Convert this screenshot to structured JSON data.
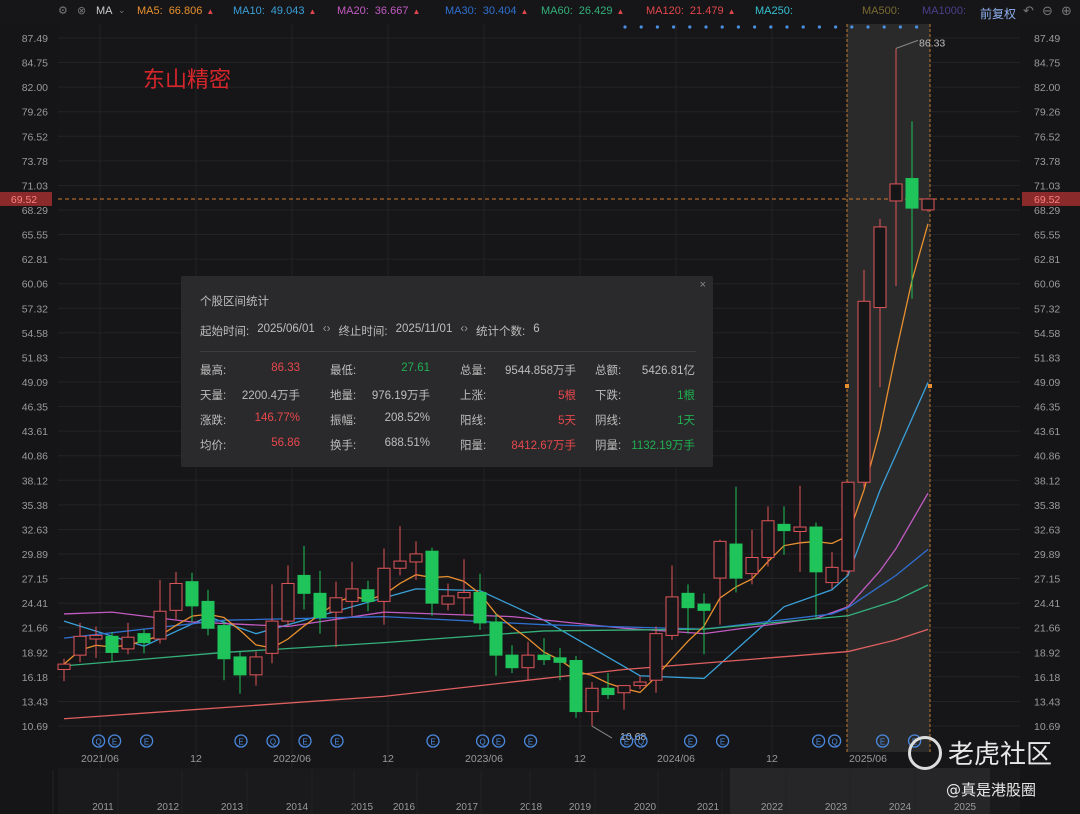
{
  "toolbar": {
    "indicator": "MA",
    "ma": [
      {
        "label": "MA5:",
        "value": "66.806",
        "color": "#e8902f",
        "up": true
      },
      {
        "label": "MA10:",
        "value": "49.043",
        "color": "#3aa0d8",
        "up": true
      },
      {
        "label": "MA20:",
        "value": "36.667",
        "color": "#c25bc2",
        "up": true
      },
      {
        "label": "MA30:",
        "value": "30.404",
        "color": "#2f70d0",
        "up": true
      },
      {
        "label": "MA60:",
        "value": "26.429",
        "color": "#34b07a",
        "up": true
      },
      {
        "label": "MA120:",
        "value": "21.479",
        "color": "#e0474c",
        "up": true
      },
      {
        "label": "MA250:",
        "value": "",
        "color": "#36c0d0",
        "up": false
      },
      {
        "label": "MA500:",
        "value": "",
        "color": "#7a6a30",
        "up": false
      },
      {
        "label": "MA1000:",
        "value": "",
        "color": "#4a3f8a",
        "up": false
      }
    ],
    "adjust": "前复权"
  },
  "stock_name": "东山精密",
  "stats_panel": {
    "title": "个股区间统计",
    "start_label": "起始时间:",
    "start_value": "2025/06/01",
    "end_label": "终止时间:",
    "end_value": "2025/11/01",
    "count_label": "统计个数:",
    "count_value": "6",
    "rows": [
      [
        {
          "k": "最高:",
          "v": "86.33",
          "c": "red"
        },
        {
          "k": "最低:",
          "v": "27.61",
          "c": "green"
        },
        {
          "k": "总量:",
          "v": "9544.858万手",
          "c": ""
        },
        {
          "k": "总额:",
          "v": "5426.81亿",
          "c": ""
        }
      ],
      [
        {
          "k": "天量:",
          "v": "2200.4万手",
          "c": ""
        },
        {
          "k": "地量:",
          "v": "976.19万手",
          "c": ""
        },
        {
          "k": "上涨:",
          "v": "5根",
          "c": "red"
        },
        {
          "k": "下跌:",
          "v": "1根",
          "c": "green"
        }
      ],
      [
        {
          "k": "涨跌:",
          "v": "146.77%",
          "c": "red"
        },
        {
          "k": "振幅:",
          "v": "208.52%",
          "c": ""
        },
        {
          "k": "阳线:",
          "v": "5天",
          "c": "red"
        },
        {
          "k": "阴线:",
          "v": "1天",
          "c": "green"
        }
      ],
      [
        {
          "k": "均价:",
          "v": "56.86",
          "c": "red"
        },
        {
          "k": "换手:",
          "v": "688.51%",
          "c": ""
        },
        {
          "k": "阳量:",
          "v": "8412.67万手",
          "c": "red"
        },
        {
          "k": "阴量:",
          "v": "1132.19万手",
          "c": "green"
        }
      ]
    ]
  },
  "watermark": {
    "brand": "老虎社区",
    "author": "@真是港股圈"
  },
  "chart_data": {
    "type": "candlestick",
    "title": "东山精密",
    "ylim": [
      10.69,
      87.49
    ],
    "y_ticks": [
      "87.49",
      "84.75",
      "82.00",
      "79.26",
      "76.52",
      "73.78",
      "71.03",
      "68.29",
      "65.55",
      "62.81",
      "60.06",
      "57.32",
      "54.58",
      "51.83",
      "49.09",
      "46.35",
      "43.61",
      "40.86",
      "38.12",
      "35.38",
      "32.63",
      "29.89",
      "27.15",
      "24.41",
      "21.66",
      "18.92",
      "16.18",
      "13.43",
      "10.69"
    ],
    "current_price": "69.52",
    "high_label": "86.33",
    "low_label": "10.68",
    "x_labels": [
      {
        "i": 2,
        "t": "2021/06"
      },
      {
        "i": 8,
        "t": "12"
      },
      {
        "i": 14,
        "t": "2022/06"
      },
      {
        "i": 20,
        "t": "12"
      },
      {
        "i": 26,
        "t": "2023/06"
      },
      {
        "i": 32,
        "t": "12"
      },
      {
        "i": 38,
        "t": "2024/06"
      },
      {
        "i": 44,
        "t": "12"
      },
      {
        "i": 50,
        "t": "2025/06"
      }
    ],
    "navigator_years": [
      "2011",
      "2012",
      "2013",
      "2014",
      "2015",
      "2016",
      "2017",
      "2018",
      "2019",
      "2020",
      "2021",
      "2022",
      "2023",
      "2024",
      "2025"
    ],
    "selection": {
      "from_index": 49,
      "to_index": 54
    },
    "candles": [
      [
        17.0,
        17.6,
        18.2,
        15.7
      ],
      [
        18.6,
        20.7,
        22.2,
        17.8
      ],
      [
        20.4,
        20.8,
        21.8,
        18.3
      ],
      [
        20.7,
        18.9,
        21.2,
        17.8
      ],
      [
        19.3,
        20.6,
        22.2,
        18.7
      ],
      [
        21.0,
        20.0,
        21.5,
        18.8
      ],
      [
        20.4,
        23.5,
        27.0,
        19.9
      ],
      [
        23.6,
        26.6,
        27.9,
        22.6
      ],
      [
        26.8,
        24.1,
        27.8,
        22.3
      ],
      [
        24.6,
        21.6,
        25.9,
        20.8
      ],
      [
        21.9,
        18.2,
        22.5,
        15.8
      ],
      [
        18.4,
        16.4,
        19.0,
        14.3
      ],
      [
        16.4,
        18.4,
        19.0,
        15.2
      ],
      [
        18.8,
        22.4,
        26.5,
        17.7
      ],
      [
        22.4,
        26.6,
        28.6,
        21.8
      ],
      [
        27.5,
        25.5,
        30.8,
        23.7
      ],
      [
        25.5,
        22.8,
        28.0,
        21.0
      ],
      [
        23.4,
        25.0,
        26.8,
        19.5
      ],
      [
        24.6,
        26.0,
        29.0,
        23.0
      ],
      [
        25.9,
        24.6,
        26.9,
        23.5
      ],
      [
        24.6,
        28.3,
        30.5,
        22.0
      ],
      [
        28.3,
        29.1,
        33.0,
        27.5
      ],
      [
        29.0,
        29.9,
        31.3,
        27.0
      ],
      [
        30.2,
        24.4,
        30.6,
        23.0
      ],
      [
        24.3,
        25.2,
        26.6,
        23.6
      ],
      [
        25.0,
        25.6,
        29.3,
        23.1
      ],
      [
        25.6,
        22.2,
        27.7,
        21.4
      ],
      [
        22.3,
        18.6,
        23.2,
        16.3
      ],
      [
        18.6,
        17.2,
        19.7,
        16.6
      ],
      [
        17.2,
        18.6,
        20.1,
        15.9
      ],
      [
        18.6,
        18.1,
        20.5,
        17.5
      ],
      [
        18.3,
        17.8,
        19.4,
        15.8
      ],
      [
        18.0,
        12.3,
        18.5,
        11.6
      ],
      [
        12.3,
        14.9,
        15.6,
        10.68
      ],
      [
        14.9,
        14.2,
        16.6,
        13.7
      ],
      [
        14.4,
        15.2,
        15.2,
        12.5
      ],
      [
        15.2,
        15.6,
        16.3,
        14.8
      ],
      [
        15.8,
        21.0,
        21.8,
        14.4
      ],
      [
        20.8,
        25.1,
        28.6,
        20.3
      ],
      [
        25.5,
        23.9,
        26.5,
        21.0
      ],
      [
        24.3,
        23.6,
        25.5,
        18.7
      ],
      [
        27.2,
        31.3,
        31.5,
        22.0
      ],
      [
        31.0,
        27.2,
        37.4,
        25.6
      ],
      [
        27.7,
        29.5,
        32.6,
        26.5
      ],
      [
        29.5,
        33.6,
        35.2,
        28.5
      ],
      [
        33.2,
        32.5,
        35.2,
        29.8
      ],
      [
        32.4,
        32.9,
        37.5,
        27.9
      ],
      [
        32.9,
        27.9,
        33.4,
        22.6
      ],
      [
        26.7,
        28.4,
        30.1,
        26.0
      ],
      [
        28.0,
        37.9,
        38.0,
        27.61
      ],
      [
        37.9,
        58.1,
        61.6,
        37.3
      ],
      [
        57.4,
        66.4,
        67.3,
        48.5
      ],
      [
        69.3,
        71.2,
        86.33,
        59.8
      ],
      [
        71.8,
        68.5,
        78.2,
        58.4
      ],
      [
        68.3,
        69.52,
        69.6,
        68.1
      ]
    ],
    "ma_series": [
      {
        "name": "MA10",
        "color": "#3aa0d8",
        "points": [
          [
            0,
            22.4
          ],
          [
            5,
            19.6
          ],
          [
            9,
            22.9
          ],
          [
            12,
            21.0
          ],
          [
            17,
            23.5
          ],
          [
            22,
            26.0
          ],
          [
            26,
            25.8
          ],
          [
            30,
            22.5
          ],
          [
            36,
            16.3
          ],
          [
            40,
            16.0
          ],
          [
            45,
            24.0
          ],
          [
            48,
            25.9
          ],
          [
            49,
            27.5
          ],
          [
            51,
            37
          ],
          [
            52,
            41
          ],
          [
            54,
            49.04
          ]
        ]
      },
      {
        "name": "MA20",
        "color": "#c25bc2",
        "points": [
          [
            0,
            23.2
          ],
          [
            3,
            23.4
          ],
          [
            8,
            22.3
          ],
          [
            14,
            21.8
          ],
          [
            20,
            23.4
          ],
          [
            28,
            22.9
          ],
          [
            35,
            21.6
          ],
          [
            40,
            21.0
          ],
          [
            47,
            22.7
          ],
          [
            49,
            24.0
          ],
          [
            51,
            28
          ],
          [
            52,
            30.5
          ],
          [
            54,
            36.67
          ]
        ]
      },
      {
        "name": "MA30",
        "color": "#2f70d0",
        "points": [
          [
            0,
            20.5
          ],
          [
            5,
            21.5
          ],
          [
            10,
            22.5
          ],
          [
            20,
            22.9
          ],
          [
            30,
            22.0
          ],
          [
            40,
            21.5
          ],
          [
            48,
            23.2
          ],
          [
            49,
            23.9
          ],
          [
            52,
            27.5
          ],
          [
            54,
            30.4
          ]
        ]
      },
      {
        "name": "MA60",
        "color": "#34b07a",
        "points": [
          [
            0,
            17.4
          ],
          [
            10,
            18.9
          ],
          [
            20,
            20.0
          ],
          [
            30,
            21.3
          ],
          [
            40,
            21.5
          ],
          [
            49,
            23.0
          ],
          [
            52,
            24.7
          ],
          [
            54,
            26.43
          ]
        ]
      },
      {
        "name": "MA120",
        "color": "#e06060",
        "points": [
          [
            0,
            11.5
          ],
          [
            20,
            14.0
          ],
          [
            35,
            17.0
          ],
          [
            49,
            19.0
          ],
          [
            52,
            20.3
          ],
          [
            54,
            21.48
          ]
        ]
      }
    ],
    "ma5_color": "#e8902f",
    "events": [
      {
        "i": 2.1,
        "t": "Q"
      },
      {
        "i": 3.1,
        "t": "E"
      },
      {
        "i": 5.1,
        "t": "E"
      },
      {
        "i": 11,
        "t": "E"
      },
      {
        "i": 13,
        "t": "Q"
      },
      {
        "i": 15,
        "t": "E"
      },
      {
        "i": 17,
        "t": "E"
      },
      {
        "i": 23,
        "t": "E"
      },
      {
        "i": 26.1,
        "t": "Q"
      },
      {
        "i": 27.1,
        "t": "E"
      },
      {
        "i": 29.1,
        "t": "E"
      },
      {
        "i": 35.1,
        "t": "E"
      },
      {
        "i": 36,
        "t": "Q"
      },
      {
        "i": 39.1,
        "t": "E"
      },
      {
        "i": 41.1,
        "t": "E"
      },
      {
        "i": 47.1,
        "t": "E"
      },
      {
        "i": 48.1,
        "t": "Q"
      },
      {
        "i": 51.1,
        "t": "E"
      },
      {
        "i": 53.1,
        "t": "E"
      }
    ]
  }
}
